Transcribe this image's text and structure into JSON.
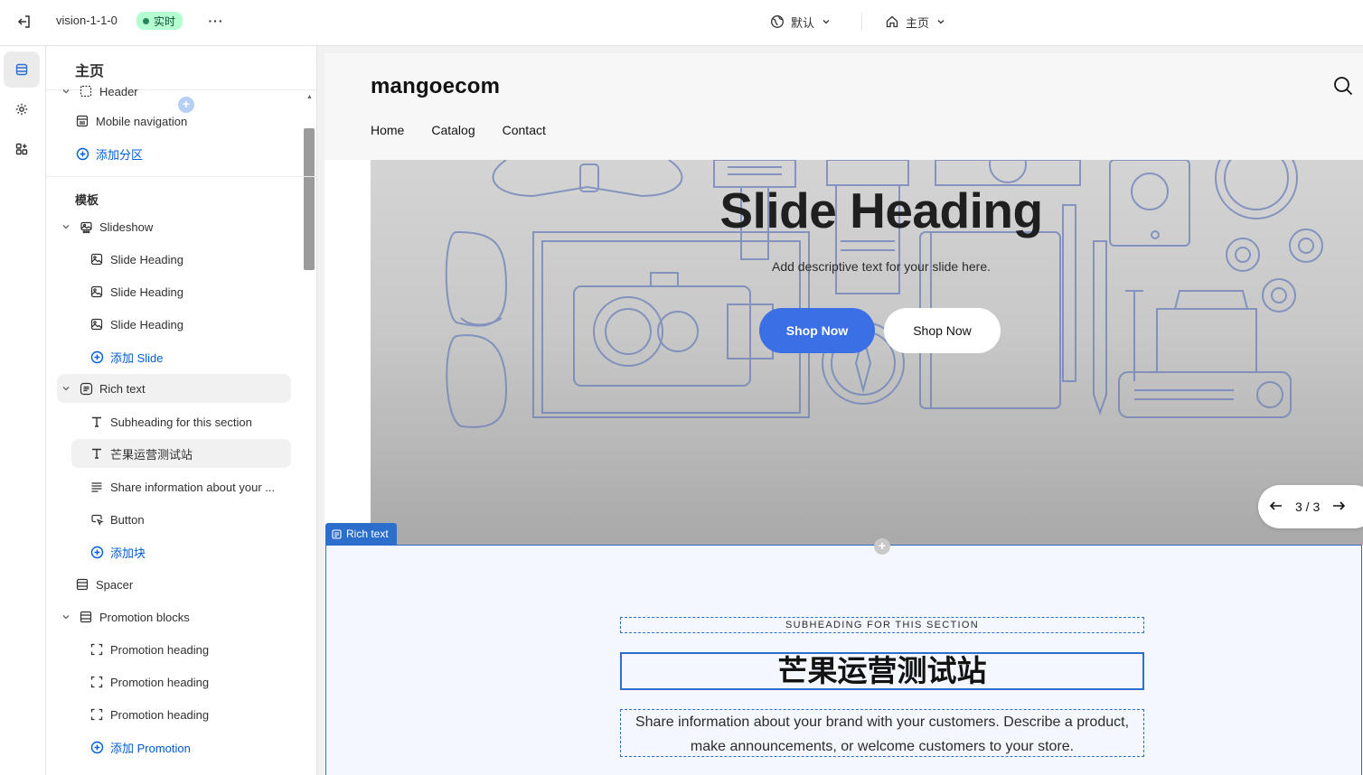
{
  "topbar": {
    "theme_name": "vision-1-1-0",
    "status_badge": "实时",
    "language_selector": "默认",
    "page_selector": "主页"
  },
  "sidebar": {
    "title": "主页",
    "header_group": {
      "items": [
        {
          "label": "Header",
          "icon": "header-section-icon"
        },
        {
          "label": "Mobile navigation",
          "icon": "section-icon"
        }
      ],
      "add_label": "添加分区"
    },
    "template_title": "模板",
    "sections": [
      {
        "label": "Slideshow",
        "icon": "slideshow-icon",
        "blocks": [
          {
            "label": "Slide Heading",
            "icon": "image-icon"
          },
          {
            "label": "Slide Heading",
            "icon": "image-icon"
          },
          {
            "label": "Slide Heading",
            "icon": "image-icon"
          }
        ],
        "add_label": "添加 Slide"
      },
      {
        "label": "Rich text",
        "icon": "rich-text-icon",
        "blocks": [
          {
            "label": "Subheading for this section",
            "icon": "text-icon"
          },
          {
            "label": "芒果运营测试站",
            "icon": "text-icon"
          },
          {
            "label": "Share information about your ...",
            "icon": "paragraph-icon"
          },
          {
            "label": "Button",
            "icon": "button-icon"
          }
        ],
        "add_label": "添加块"
      },
      {
        "label": "Spacer",
        "icon": "spacer-icon"
      },
      {
        "label": "Promotion blocks",
        "icon": "section-icon",
        "blocks": [
          {
            "label": "Promotion heading",
            "icon": "dashed-square-icon"
          },
          {
            "label": "Promotion heading",
            "icon": "dashed-square-icon"
          },
          {
            "label": "Promotion heading",
            "icon": "dashed-square-icon"
          }
        ],
        "add_label": "添加 Promotion"
      }
    ]
  },
  "preview": {
    "store": {
      "logo": "mangoecom",
      "nav": [
        "Home",
        "Catalog",
        "Contact"
      ]
    },
    "slideshow": {
      "heading": "Slide Heading",
      "text": "Add descriptive text for your slide here.",
      "button_primary": "Shop Now",
      "button_secondary": "Shop Now",
      "pager": "3 / 3"
    },
    "rich_text": {
      "tag": "Rich text",
      "subheading": "SUBHEADING FOR THIS SECTION",
      "heading": "芒果运营测试站",
      "text": "Share information about your brand with your customers. Describe a product, make announcements, or welcome customers to your store."
    }
  },
  "colors": {
    "accent": "#2c6ecb",
    "badge_bg": "#b4fed2",
    "link": "#005bd3",
    "shop_now_primary": "#3b6fe6"
  }
}
